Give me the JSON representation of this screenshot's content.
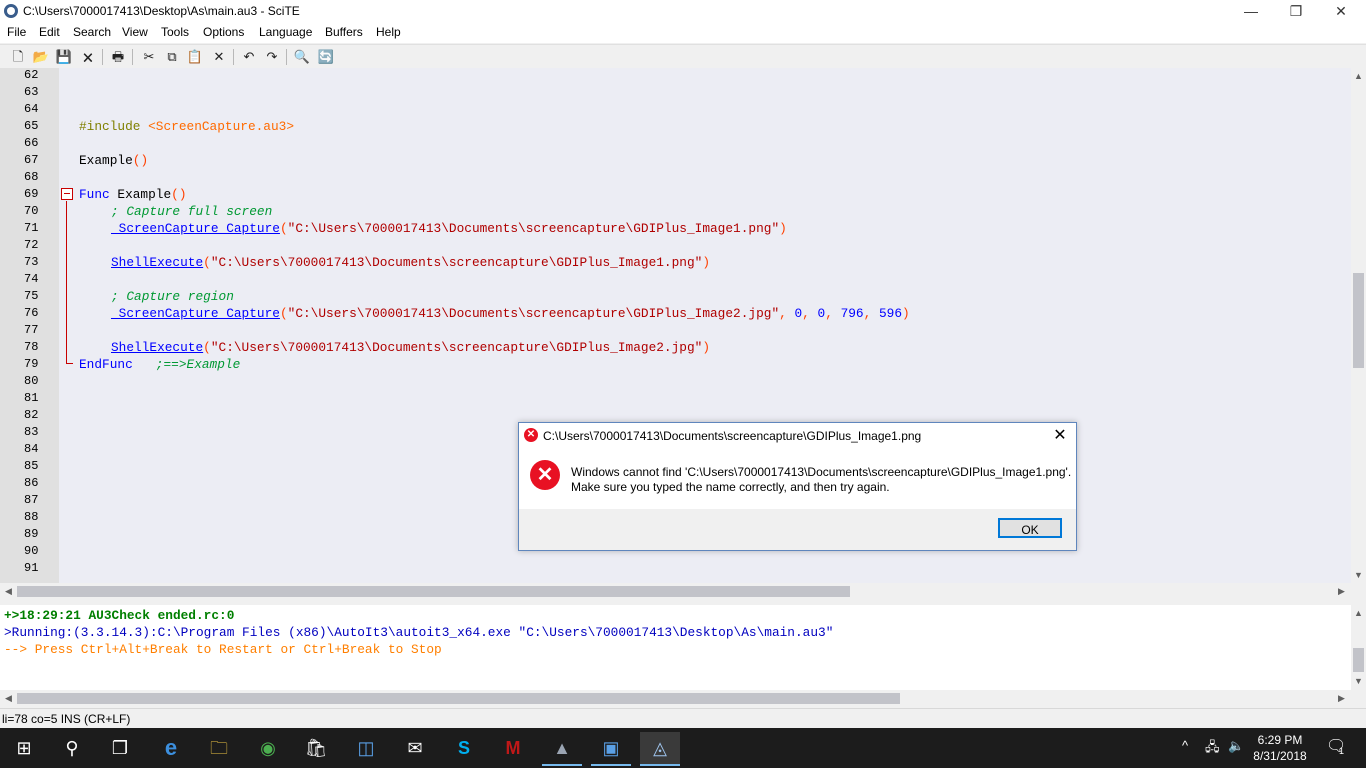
{
  "window": {
    "title": "C:\\Users\\7000017413\\Desktop\\As\\main.au3 - SciTE",
    "minimize_glyph": "—",
    "restore_glyph": "❐",
    "close_glyph": "✕"
  },
  "menu": [
    "File",
    "Edit",
    "Search",
    "View",
    "Tools",
    "Options",
    "Language",
    "Buffers",
    "Help"
  ],
  "toolbar": [
    {
      "name": "new-file-icon",
      "glyph": "🗋"
    },
    {
      "name": "open-file-icon",
      "glyph": "📂"
    },
    {
      "name": "save-icon",
      "glyph": "💾"
    },
    {
      "name": "close-file-icon",
      "glyph": "🗙"
    },
    {
      "name": "print-icon",
      "glyph": "🖶"
    },
    {
      "name": "cut-icon",
      "glyph": "✂"
    },
    {
      "name": "copy-icon",
      "glyph": "⧉"
    },
    {
      "name": "paste-icon",
      "glyph": "📋"
    },
    {
      "name": "delete-icon",
      "glyph": "✕"
    },
    {
      "name": "undo-icon",
      "glyph": "↶"
    },
    {
      "name": "redo-icon",
      "glyph": "↷"
    },
    {
      "name": "find-icon",
      "glyph": "🔍"
    },
    {
      "name": "replace-icon",
      "glyph": "🔄"
    }
  ],
  "line_numbers": [
    "62",
    "63",
    "64",
    "65",
    "66",
    "67",
    "68",
    "69",
    "70",
    "71",
    "72",
    "73",
    "74",
    "75",
    "76",
    "77",
    "78",
    "79",
    "80",
    "81",
    "82",
    "83",
    "84",
    "85",
    "86",
    "87",
    "88",
    "89",
    "90",
    "91"
  ],
  "code": {
    "l65_dir": "#include",
    "l65_inc": " <ScreenCapture.au3>",
    "l67_fn": "Example",
    "l67_op": "()",
    "l69_kw": "Func",
    "l69_fn": " Example",
    "l69_op": "()",
    "l70_cm": "; Capture full screen",
    "l71_fn": "_ScreenCapture_Capture",
    "l71_op1": "(",
    "l71_str": "\"C:\\Users\\7000017413\\Documents\\screencapture\\GDIPlus_Image1.png\"",
    "l71_op2": ")",
    "l73_fn": "ShellExecute",
    "l73_op1": "(",
    "l73_str": "\"C:\\Users\\7000017413\\Documents\\screencapture\\GDIPlus_Image1.png\"",
    "l73_op2": ")",
    "l75_cm": "; Capture region",
    "l76_fn": "_ScreenCapture_Capture",
    "l76_op1": "(",
    "l76_str": "\"C:\\Users\\7000017413\\Documents\\screencapture\\GDIPlus_Image2.jpg\"",
    "l76_c1": ", ",
    "l76_n1": "0",
    "l76_c2": ", ",
    "l76_n2": "0",
    "l76_c3": ", ",
    "l76_n3": "796",
    "l76_c4": ", ",
    "l76_n4": "596",
    "l76_op2": ")",
    "l78_fn": "ShellExecute",
    "l78_op1": "(",
    "l78_str": "\"C:\\Users\\7000017413\\Documents\\screencapture\\GDIPlus_Image2.jpg\"",
    "l78_op2": ")",
    "l79_kw": "EndFunc",
    "l79_cm": "   ;==>Example"
  },
  "output": {
    "line1": "+>18:29:21 AU3Check ended.rc:0",
    "line2": ">Running:(3.3.14.3):C:\\Program Files (x86)\\AutoIt3\\autoit3_x64.exe \"C:\\Users\\7000017413\\Desktop\\As\\main.au3\"",
    "line3": "--> Press Ctrl+Alt+Break to Restart or Ctrl+Break to Stop"
  },
  "status": "li=78 co=5 INS (CR+LF)",
  "dialog": {
    "title": "C:\\Users\\7000017413\\Documents\\screencapture\\GDIPlus_Image1.png",
    "message_line1": "Windows cannot find 'C:\\Users\\7000017413\\Documents\\screencapture\\GDIPlus_Image1.png'.",
    "message_line2": "Make sure you typed the name correctly, and then try again.",
    "ok_label": "OK",
    "close_glyph": "✕",
    "error_glyph": "✕"
  },
  "taskbar": {
    "items": [
      {
        "name": "start-icon",
        "glyph": "⊞"
      },
      {
        "name": "search-icon",
        "glyph": "⚲"
      },
      {
        "name": "task-view-icon",
        "glyph": "❐"
      },
      {
        "name": "edge-icon",
        "glyph": "e"
      },
      {
        "name": "file-explorer-icon",
        "glyph": "🗀"
      },
      {
        "name": "chrome-icon",
        "glyph": "◉"
      },
      {
        "name": "store-icon",
        "glyph": "🛍"
      },
      {
        "name": "app-icon-blue",
        "glyph": "◫"
      },
      {
        "name": "mail-icon",
        "glyph": "✉"
      },
      {
        "name": "skype-icon",
        "glyph": "S"
      },
      {
        "name": "mcafee-icon",
        "glyph": "M"
      },
      {
        "name": "autoit-icon",
        "glyph": "▲"
      },
      {
        "name": "app-window-icon",
        "glyph": "▣"
      },
      {
        "name": "scite-icon",
        "glyph": "◬"
      }
    ],
    "time": "6:29 PM",
    "date": "8/31/2018",
    "tray_chevron": "^",
    "notification_count": "1"
  }
}
